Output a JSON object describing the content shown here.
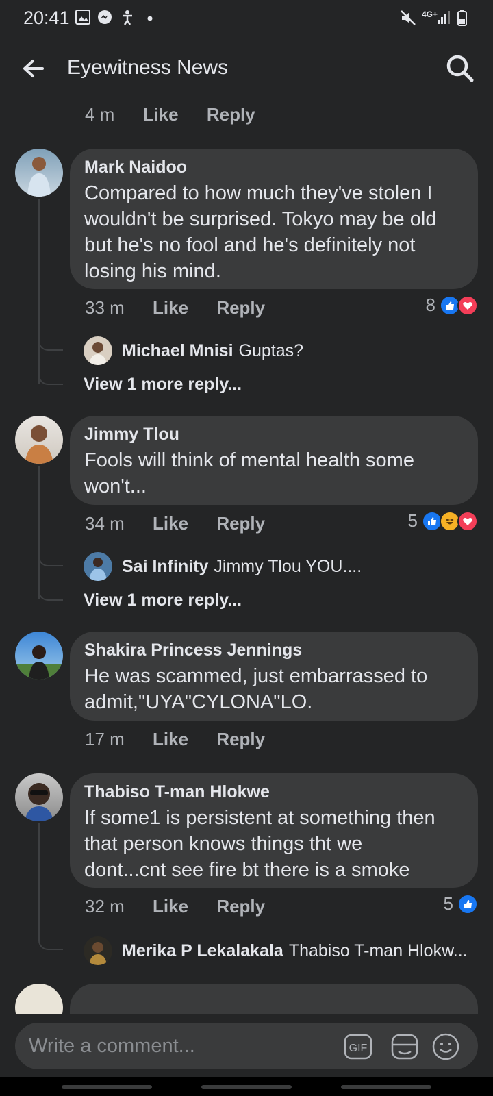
{
  "status_bar": {
    "time": "20:41",
    "network": "4G+"
  },
  "header": {
    "title": "Eyewitness News"
  },
  "top_meta": {
    "time": "4 m",
    "like": "Like",
    "reply": "Reply"
  },
  "comments": [
    {
      "author": "Mark Naidoo",
      "lines": [
        "Compared to how much they've stolen I",
        "wouldn't be surprised. Tokyo may be old",
        "but he's no fool and he's definitely not",
        "losing his mind."
      ],
      "time": "33 m",
      "like": "Like",
      "reply": "Reply",
      "reaction_count": "8",
      "reactions": [
        "like-reaction-icon",
        "love-reaction-icon"
      ],
      "replies": [
        {
          "author": "Michael Mnisi",
          "text": "Guptas?"
        }
      ],
      "more_replies": "View 1 more reply..."
    },
    {
      "author": "Jimmy Tlou",
      "lines": [
        "Fools will think of mental health some",
        "won't..."
      ],
      "time": "34 m",
      "like": "Like",
      "reply": "Reply",
      "reaction_count": "5",
      "reactions": [
        "like-reaction-icon",
        "haha-reaction-icon",
        "love-reaction-icon"
      ],
      "replies": [
        {
          "author": "Sai Infinity",
          "text": "Jimmy Tlou YOU...."
        }
      ],
      "more_replies": "View 1 more reply..."
    },
    {
      "author": "Shakira Princess Jennings",
      "lines": [
        "He was scammed, just embarrassed to",
        "admit,\"UYA\"CYLONA\"LO."
      ],
      "time": "17 m",
      "like": "Like",
      "reply": "Reply"
    },
    {
      "author": "Thabiso T-man Hlokwe",
      "lines": [
        "If some1 is persistent at something then",
        "that person knows things tht we",
        "dont...cnt see fire bt there is a smoke"
      ],
      "time": "32 m",
      "like": "Like",
      "reply": "Reply",
      "reaction_count": "5",
      "reactions": [
        "like-reaction-icon"
      ],
      "replies": [
        {
          "author": "Merika P Lekalakala",
          "text": "Thabiso T-man Hlokw..."
        }
      ]
    }
  ],
  "composer": {
    "placeholder": "Write a comment...",
    "gif_label": "GIF"
  },
  "colors": {
    "background": "#242526",
    "bubble": "#3a3b3c",
    "like_blue": "#1877f2",
    "love_red": "#f33e58",
    "haha_yellow": "#f7b125"
  }
}
